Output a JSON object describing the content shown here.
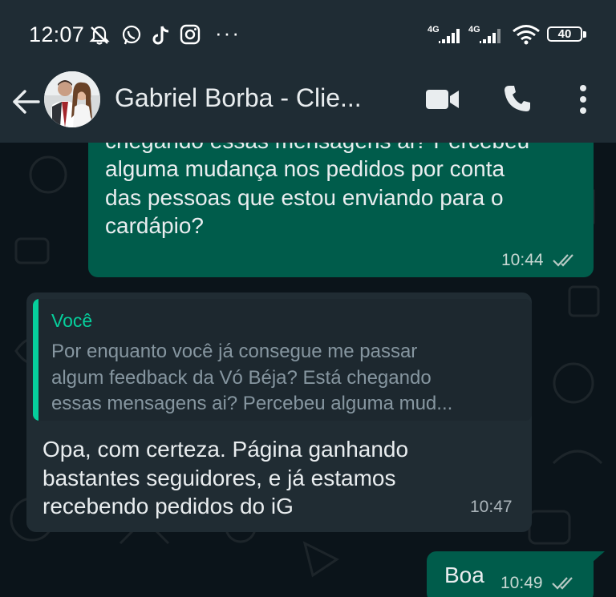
{
  "status_bar": {
    "time": "12:07",
    "network_1": "4G",
    "network_2": "4G",
    "battery": "40",
    "more": "···"
  },
  "header": {
    "contact_name": "Gabriel Borba - Clie..."
  },
  "messages": [
    {
      "direction": "outgoing",
      "text": "chegando essas mensagens ai? Percebeu\nalguma mudança nos pedidos por conta\ndas pessoas que estou enviando para o\ncardápio?",
      "time": "10:44"
    },
    {
      "direction": "incoming",
      "quote_author": "Você",
      "quote_text": "Por enquanto você já consegue me passar\nalgum feedback da Vó Béja? Está chegando\nessas mensagens ai? Percebeu alguma mud...",
      "text": "Opa, com certeza. Página ganhando\nbastantes seguidores, e já estamos\nrecebendo pedidos do iG",
      "time": "10:47"
    },
    {
      "direction": "outgoing",
      "text": "Boa",
      "time": "10:49"
    }
  ],
  "colors": {
    "header_bg": "#1f2c34",
    "chat_bg": "#0b141a",
    "outgoing_bubble": "#005c4b",
    "incoming_bubble": "#202c33",
    "accent": "#06cf9c"
  }
}
